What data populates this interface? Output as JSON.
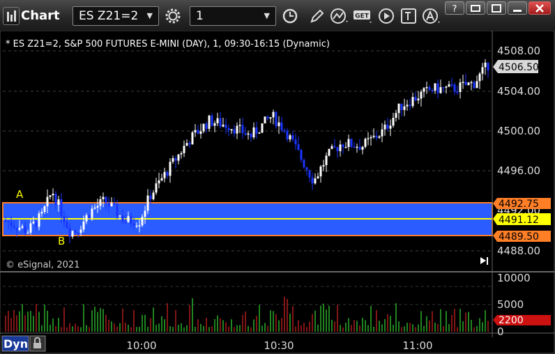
{
  "window": {
    "title": "Chart"
  },
  "toolbar": {
    "symbol": "ES Z21=2",
    "interval": "1",
    "get_label": "GET"
  },
  "chart": {
    "header": "* ES Z21=2, S&P 500 FUTURES E-MINI (DAY), 1, 09:30-16:15 (Dynamic)",
    "copyright": "© eSignal, 2021",
    "label_a": "A",
    "label_b": "B",
    "price_ticks": [
      "4508.00",
      "4504.00",
      "4500.00",
      "4496.00",
      "4492.00",
      "4488.00"
    ],
    "last_price": "4506.50",
    "level_upper": "4492.75",
    "level_mid": "4491.12",
    "level_lower": "4489.50",
    "volume_ticks": [
      "10000",
      "5000",
      "0"
    ],
    "volume_last": "2200",
    "time_ticks": [
      "10:00",
      "10:30",
      "11:00"
    ],
    "bottom_label": "Dyn"
  },
  "colors": {
    "zone_fill": "#2a5cff",
    "zone_border": "#ff7f27",
    "mid_line": "#ffff00",
    "up_bar": "#ffffff",
    "down_bar": "#1a33ff",
    "vol_up": "#33cc33",
    "vol_down": "#cc2222"
  }
}
